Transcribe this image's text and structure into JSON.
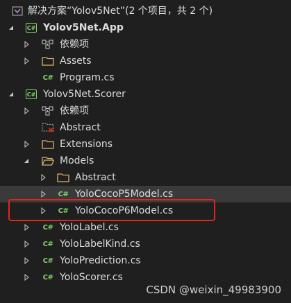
{
  "solution": {
    "label": "解决方案“Yolov5Net”(2 个项目，共 2 个)"
  },
  "tree": [
    {
      "label": "Yolov5Net.App",
      "icon": "csharp-project-icon"
    },
    {
      "label": "依赖项",
      "icon": "dependencies-icon"
    },
    {
      "label": "Assets",
      "icon": "folder-icon"
    },
    {
      "label": "Program.cs",
      "icon": "csharp-file-icon"
    },
    {
      "label": "Yolov5Net.Scorer",
      "icon": "csharp-project-icon"
    },
    {
      "label": "依赖项",
      "icon": "dependencies-icon"
    },
    {
      "label": "Abstract",
      "icon": "excluded-folder-icon"
    },
    {
      "label": "Extensions",
      "icon": "folder-icon"
    },
    {
      "label": "Models",
      "icon": "folder-open-icon"
    },
    {
      "label": "Abstract",
      "icon": "folder-icon"
    },
    {
      "label": "YoloCocoP5Model.cs",
      "icon": "csharp-file-icon"
    },
    {
      "label": "YoloCocoP6Model.cs",
      "icon": "csharp-file-icon"
    },
    {
      "label": "YoloLabel.cs",
      "icon": "csharp-file-icon"
    },
    {
      "label": "YoloLabelKind.cs",
      "icon": "csharp-file-icon"
    },
    {
      "label": "YoloPrediction.cs",
      "icon": "csharp-file-icon"
    },
    {
      "label": "YoloScorer.cs",
      "icon": "csharp-file-icon"
    }
  ],
  "csharp_badge": "C#",
  "watermark": "CSDN @weixin_49983900",
  "colors": {
    "background": "#1f1f1f",
    "text": "#dcdcdc",
    "csharp": "#7fd36b",
    "folder": "#d7b46a",
    "highlight": "#e0261d",
    "selected_row": "#3a3a3a"
  }
}
